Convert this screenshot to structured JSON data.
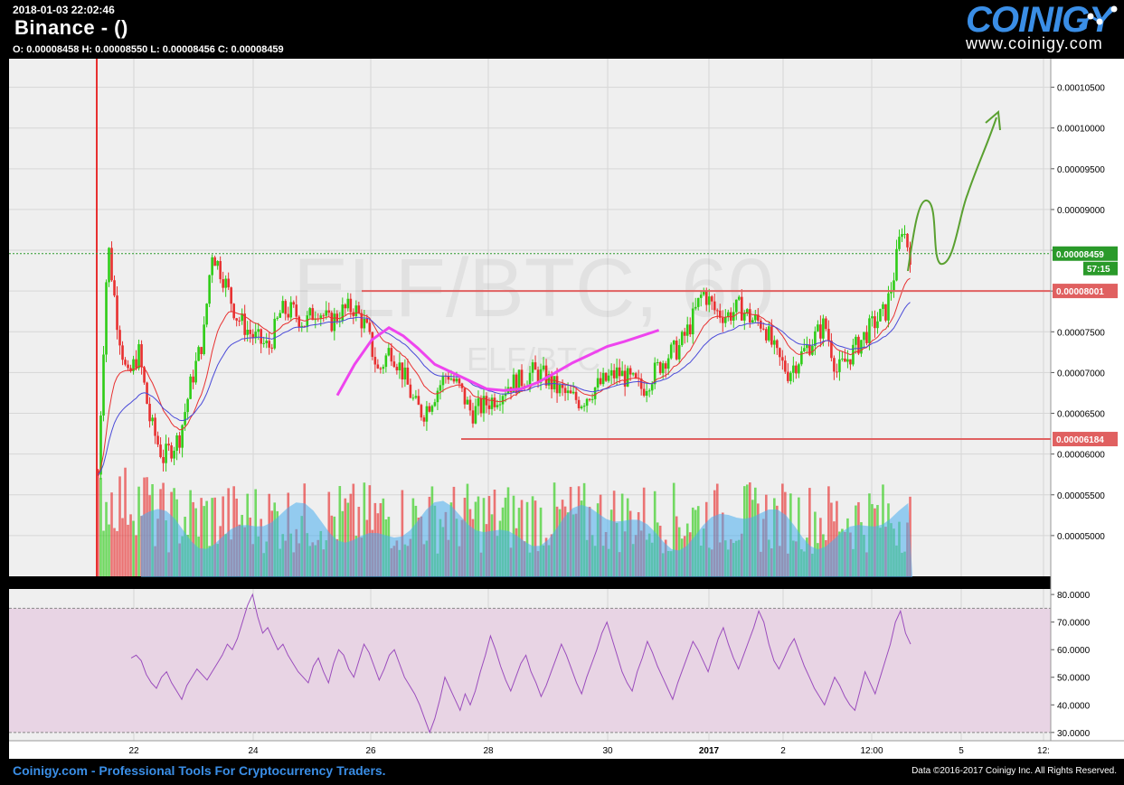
{
  "header": {
    "datetime": "2018-01-03 22:02:46",
    "title": "Binance -  ()",
    "ohlc": "O: 0.00008458 H: 0.00008550 L: 0.00008456 C: 0.00008459"
  },
  "logo": {
    "word": "COINIGY",
    "url": "www.coinigy.com"
  },
  "footer": {
    "left": "Coinigy.com - Professional Tools For Cryptocurrency Traders.",
    "right": "Data ©2016-2017 Coinigy Inc. All Rights Reserved."
  },
  "watermark": {
    "pair": "ELF/BTC, 60",
    "sub": "ELF/BTC"
  },
  "colors": {
    "background": "#000000",
    "plot_bg": "#efefef",
    "grid": "#d6d6d6",
    "up": "#2ecc16",
    "down": "#e83030",
    "ema_fast": "#e83030",
    "ema_slow": "#4a4ad8",
    "ma_long": "#ee44ee",
    "volume_avg": "#49aef0",
    "rsi_line": "#9b4dbd",
    "rsi_band": "#e8d4e4",
    "level_line": "#e06060",
    "price_line": "#2a9a2a",
    "drawing": "#5aa030",
    "logo": "#3a8ee6"
  },
  "chart_data": {
    "type": "candlestick",
    "price_axis": {
      "ticks": [
        "0.00010500",
        "0.00010000",
        "0.00009500",
        "0.00009000",
        "0.00008500",
        "0.00008000",
        "0.00007500",
        "0.00007000",
        "0.00006500",
        "0.00006000",
        "0.00005500",
        "0.00005000"
      ],
      "range": [
        4.5e-05,
        0.0001085
      ]
    },
    "time_axis": {
      "ticks": [
        "22",
        "24",
        "26",
        "28",
        "30",
        "2017",
        "2",
        "12:00",
        "5",
        "12:"
      ]
    },
    "current_price": {
      "label": "0.00008459",
      "value": 8.459e-05,
      "countdown": "57:15"
    },
    "levels": [
      {
        "label": "0.00008001",
        "value": 8.001e-05
      },
      {
        "label": "0.00006184",
        "value": 6.184e-05
      }
    ],
    "price_path": [
      [
        0.0,
        5.75e-05
      ],
      [
        0.012,
        8.6e-05
      ],
      [
        0.024,
        7.6e-05
      ],
      [
        0.036,
        6.9e-05
      ],
      [
        0.05,
        7.25e-05
      ],
      [
        0.064,
        6.4e-05
      ],
      [
        0.08,
        5.95e-05
      ],
      [
        0.1,
        6.2e-05
      ],
      [
        0.115,
        6.9e-05
      ],
      [
        0.13,
        7.45e-05
      ],
      [
        0.14,
        8.5e-05
      ],
      [
        0.155,
        8.15e-05
      ],
      [
        0.17,
        7.7e-05
      ],
      [
        0.19,
        7.45e-05
      ],
      [
        0.21,
        7.3e-05
      ],
      [
        0.225,
        7.75e-05
      ],
      [
        0.24,
        7.75e-05
      ],
      [
        0.255,
        7.6e-05
      ],
      [
        0.27,
        7.8e-05
      ],
      [
        0.285,
        7.6e-05
      ],
      [
        0.3,
        7.75e-05
      ],
      [
        0.315,
        7.8e-05
      ],
      [
        0.33,
        7.55e-05
      ],
      [
        0.345,
        7e-05
      ],
      [
        0.36,
        7.3e-05
      ],
      [
        0.375,
        7e-05
      ],
      [
        0.39,
        6.6e-05
      ],
      [
        0.4,
        6.5e-05
      ],
      [
        0.415,
        6.75e-05
      ],
      [
        0.43,
        7e-05
      ],
      [
        0.445,
        6.8e-05
      ],
      [
        0.46,
        6.5e-05
      ],
      [
        0.475,
        6.6e-05
      ],
      [
        0.49,
        6.7e-05
      ],
      [
        0.505,
        6.85e-05
      ],
      [
        0.52,
        6.9e-05
      ],
      [
        0.535,
        7e-05
      ],
      [
        0.55,
        6.95e-05
      ],
      [
        0.565,
        6.8e-05
      ],
      [
        0.58,
        6.7e-05
      ],
      [
        0.595,
        6.65e-05
      ],
      [
        0.61,
        6.8e-05
      ],
      [
        0.625,
        6.9e-05
      ],
      [
        0.64,
        7e-05
      ],
      [
        0.655,
        6.9e-05
      ],
      [
        0.67,
        6.8e-05
      ],
      [
        0.685,
        7e-05
      ],
      [
        0.7,
        7.2e-05
      ],
      [
        0.715,
        7.3e-05
      ],
      [
        0.73,
        7.6e-05
      ],
      [
        0.745,
        8e-05
      ],
      [
        0.76,
        7.75e-05
      ],
      [
        0.775,
        7.7e-05
      ],
      [
        0.79,
        7.8e-05
      ],
      [
        0.805,
        7.65e-05
      ],
      [
        0.82,
        7.6e-05
      ],
      [
        0.835,
        7.2e-05
      ],
      [
        0.85,
        7e-05
      ],
      [
        0.865,
        7.2e-05
      ],
      [
        0.88,
        7.4e-05
      ],
      [
        0.895,
        7.6e-05
      ],
      [
        0.91,
        7e-05
      ],
      [
        0.925,
        7.2e-05
      ],
      [
        0.94,
        7.4e-05
      ],
      [
        0.955,
        7.6e-05
      ],
      [
        0.97,
        7.75e-05
      ],
      [
        0.98,
        8.2e-05
      ],
      [
        0.99,
        8.8e-05
      ],
      [
        1.0,
        8.46e-05
      ]
    ],
    "ma_long_path": [
      [
        0.0,
        6.72e-05
      ],
      [
        0.03,
        7.1e-05
      ],
      [
        0.06,
        7.4e-05
      ],
      [
        0.09,
        7.55e-05
      ],
      [
        0.115,
        7.45e-05
      ],
      [
        0.14,
        7.3e-05
      ],
      [
        0.17,
        7.1e-05
      ],
      [
        0.2,
        7e-05
      ],
      [
        0.23,
        6.9e-05
      ],
      [
        0.26,
        6.8e-05
      ],
      [
        0.29,
        6.78e-05
      ],
      [
        0.32,
        6.8e-05
      ],
      [
        0.35,
        6.88e-05
      ],
      [
        0.38,
        7e-05
      ],
      [
        0.41,
        7.12e-05
      ],
      [
        0.44,
        7.22e-05
      ],
      [
        0.47,
        7.32e-05
      ],
      [
        0.5,
        7.38e-05
      ],
      [
        0.53,
        7.45e-05
      ],
      [
        0.56,
        7.52e-05
      ]
    ],
    "volume_axis": {
      "ticks": []
    },
    "rsi": {
      "ticks": [
        "80.0000",
        "70.0000",
        "60.0000",
        "50.0000",
        "40.0000",
        "30.0000"
      ],
      "range": [
        27,
        82
      ],
      "bands": [
        30,
        75
      ],
      "values": [
        57,
        58,
        56,
        51,
        48,
        46,
        50,
        52,
        48,
        45,
        42,
        47,
        50,
        53,
        51,
        49,
        52,
        55,
        58,
        62,
        60,
        64,
        70,
        76,
        80,
        72,
        66,
        68,
        64,
        60,
        62,
        58,
        55,
        52,
        50,
        48,
        54,
        57,
        52,
        48,
        55,
        60,
        58,
        53,
        50,
        56,
        62,
        59,
        54,
        49,
        53,
        58,
        60,
        55,
        50,
        47,
        44,
        40,
        35,
        30,
        35,
        42,
        50,
        46,
        42,
        38,
        44,
        40,
        45,
        52,
        58,
        65,
        60,
        54,
        49,
        45,
        50,
        55,
        58,
        52,
        48,
        43,
        47,
        52,
        57,
        62,
        58,
        53,
        48,
        44,
        50,
        55,
        60,
        66,
        70,
        64,
        58,
        52,
        48,
        45,
        52,
        57,
        63,
        59,
        54,
        50,
        46,
        42,
        48,
        53,
        58,
        63,
        60,
        56,
        52,
        58,
        64,
        68,
        62,
        57,
        53,
        58,
        63,
        68,
        74,
        70,
        62,
        56,
        53,
        57,
        61,
        64,
        59,
        54,
        50,
        46,
        43,
        40,
        45,
        50,
        47,
        43,
        40,
        38,
        45,
        52,
        48,
        44,
        50,
        56,
        62,
        70,
        74,
        66,
        62
      ]
    },
    "annotation": "freehand projection arrow"
  }
}
